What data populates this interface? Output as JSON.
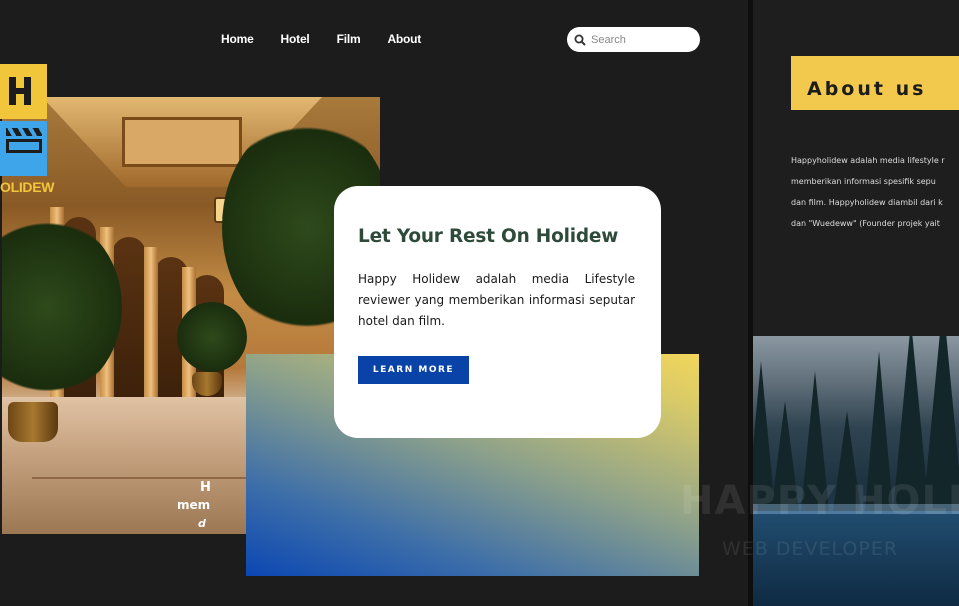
{
  "nav": {
    "items": [
      {
        "label": "Home"
      },
      {
        "label": "Hotel"
      },
      {
        "label": "Film"
      },
      {
        "label": "About"
      }
    ]
  },
  "search": {
    "placeholder": "Search",
    "icon": "search-icon"
  },
  "logo": {
    "text": "OLIDEW",
    "colors": {
      "h_block": "#f1c63a",
      "film_block": "#3ea5ea"
    }
  },
  "hero": {
    "title": "Let Your Rest On Holidew",
    "description": "Happy Holidew adalah media Lifestyle reviewer yang memberikan informasi seputar hotel dan film.",
    "button_label": "LEARN MORE",
    "colors": {
      "title": "#2e4a3a",
      "button": "#0a43a8"
    }
  },
  "about": {
    "heading": "About us",
    "lines": [
      "Happyholidew adalah media lifestyle r",
      "memberikan informasi spesifik sepu",
      "dan film. Happyholidew diambil dari k",
      "dan \"Wuedeww\" (Founder projek yait"
    ],
    "accent": "#f2c94c"
  },
  "watermark": {
    "title": "HAPPY HOLIDEW",
    "subtitle": "WEB DEVELOPER"
  },
  "forest_overlay": {
    "line1": "H",
    "line2": "mem",
    "line3": "d"
  }
}
